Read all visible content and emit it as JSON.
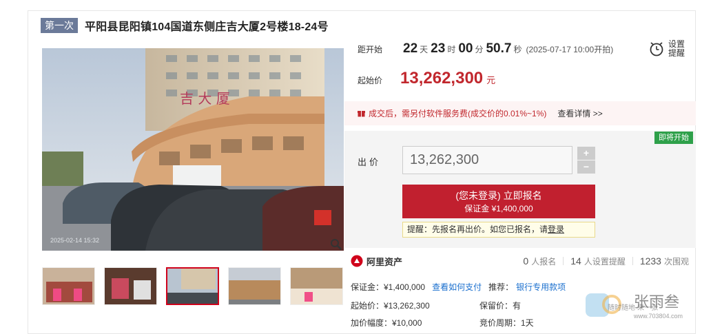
{
  "header": {
    "round_badge": "第一次",
    "title": "平阳县昆阳镇104国道东侧庄吉大厦2号楼18-24号"
  },
  "photo": {
    "timestamp": "2025-02-14 15:32",
    "building_sign": "吉 大 厦"
  },
  "countdown": {
    "label": "距开始",
    "days": "22",
    "days_unit": "天",
    "hours": "23",
    "hours_unit": "时",
    "minutes": "00",
    "minutes_unit": "分",
    "seconds": "50.7",
    "seconds_unit": "秒",
    "start_note": "(2025-07-17 10:00开拍)"
  },
  "remind": {
    "line1": "设置",
    "line2": "提醒"
  },
  "start_price": {
    "label": "起始价",
    "value": "13,262,300",
    "unit": "元"
  },
  "fee_notice": {
    "text": "成交后，需另付软件服务费(成交价的0.01%~1%)",
    "link": "查看详情 >>"
  },
  "bid": {
    "status_tag": "即将开始",
    "label": "出价",
    "value": "13,262,300",
    "plus": "+",
    "minus": "−"
  },
  "signup": {
    "line1": "(您未登录) 立即报名",
    "line2": "保证金 ¥1,400,000"
  },
  "hint": {
    "text": "提醒：先报名再出价。如您已报名，请",
    "link": "登录"
  },
  "brand": {
    "name": "阿里资产"
  },
  "stats": {
    "signed": "0",
    "signed_label": "人报名",
    "reminders": "14",
    "reminders_label": "人设置提醒",
    "views": "1233",
    "views_label": "次围观"
  },
  "details": {
    "deposit": "保证金：¥1,400,000",
    "how_pay": "查看如何支付",
    "recommend": "推荐：",
    "bank_loan": "银行专用款项",
    "start_price": "起始价：¥13,262,300",
    "reserve": "保留价：有",
    "increment": "加价幅度：¥10,000",
    "cycle": "竞价周期：1天"
  },
  "watermark": {
    "brand": "张雨叁",
    "slogan": "随时随地 来一张",
    "url": "www.703804.com"
  },
  "colors": {
    "accent_red": "#c1272d",
    "button_red": "#c1202f",
    "badge_gray": "#6b7a99",
    "green_tag": "#2ea04a",
    "link_blue": "#1a6fce"
  }
}
